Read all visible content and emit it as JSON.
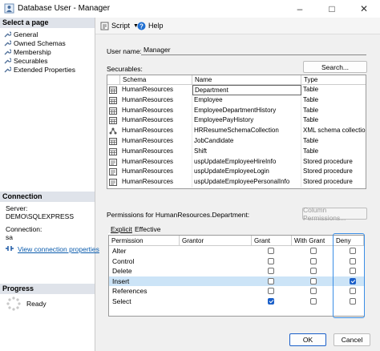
{
  "window": {
    "title": "Database User - Manager"
  },
  "left": {
    "select_page_header": "Select a page",
    "pages": [
      "General",
      "Owned Schemas",
      "Membership",
      "Securables",
      "Extended Properties"
    ],
    "connection_header": "Connection",
    "server_label": "Server:",
    "server_value": "DEMO\\SQLEXPRESS",
    "connection_label": "Connection:",
    "connection_value": "sa",
    "view_props_link": "View connection properties",
    "progress_header": "Progress",
    "progress_status": "Ready"
  },
  "toolbar": {
    "script_label": "Script",
    "help_label": "Help"
  },
  "main": {
    "user_name_label": "User name:",
    "user_name_value": "Manager",
    "securables_label": "Securables:",
    "search_button": "Search...",
    "securables_columns": [
      "Schema",
      "Name",
      "Type"
    ],
    "securables_rows": [
      {
        "schema": "HumanResources",
        "name": "Department",
        "type": "Table",
        "icon": "table-icon"
      },
      {
        "schema": "HumanResources",
        "name": "Employee",
        "type": "Table",
        "icon": "table-icon"
      },
      {
        "schema": "HumanResources",
        "name": "EmployeeDepartmentHistory",
        "type": "Table",
        "icon": "table-icon"
      },
      {
        "schema": "HumanResources",
        "name": "EmployeePayHistory",
        "type": "Table",
        "icon": "table-icon"
      },
      {
        "schema": "HumanResources",
        "name": "HRResumeSchemaCollection",
        "type": "XML schema collection",
        "icon": "schema-icon"
      },
      {
        "schema": "HumanResources",
        "name": "JobCandidate",
        "type": "Table",
        "icon": "table-icon"
      },
      {
        "schema": "HumanResources",
        "name": "Shift",
        "type": "Table",
        "icon": "table-icon"
      },
      {
        "schema": "HumanResources",
        "name": "uspUpdateEmployeeHireInfo",
        "type": "Stored procedure",
        "icon": "procedure-icon"
      },
      {
        "schema": "HumanResources",
        "name": "uspUpdateEmployeeLogin",
        "type": "Stored procedure",
        "icon": "procedure-icon"
      },
      {
        "schema": "HumanResources",
        "name": "uspUpdateEmployeePersonalInfo",
        "type": "Stored procedure",
        "icon": "procedure-icon"
      }
    ],
    "permissions_label": "Permissions for HumanResources.Department:",
    "column_permissions_button": "Column Permissions...",
    "tabs": [
      "Explicit",
      "Effective"
    ],
    "perm_columns": [
      "Permission",
      "Grantor",
      "Grant",
      "With Grant",
      "Deny"
    ],
    "permissions": [
      {
        "name": "Alter",
        "grantor": "",
        "grant": false,
        "with_grant": false,
        "deny": false
      },
      {
        "name": "Control",
        "grantor": "",
        "grant": false,
        "with_grant": false,
        "deny": false
      },
      {
        "name": "Delete",
        "grantor": "",
        "grant": false,
        "with_grant": false,
        "deny": false
      },
      {
        "name": "Insert",
        "grantor": "",
        "grant": false,
        "with_grant": false,
        "deny": true
      },
      {
        "name": "References",
        "grantor": "",
        "grant": false,
        "with_grant": false,
        "deny": false
      },
      {
        "name": "Select",
        "grantor": "",
        "grant": true,
        "with_grant": false,
        "deny": false
      }
    ]
  },
  "footer": {
    "ok": "OK",
    "cancel": "Cancel"
  },
  "colors": {
    "selection": "#cce4f7",
    "checked": "#1a5fc9",
    "link": "#0b5cad",
    "highlight_box": "#3a8ee6"
  }
}
